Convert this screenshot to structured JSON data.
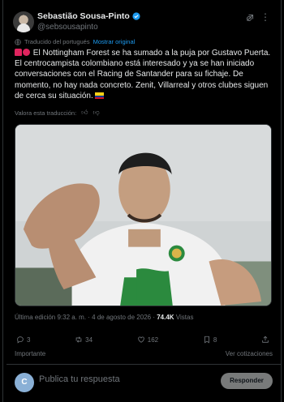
{
  "header": {
    "name": "Sebastião Sousa-Pinto",
    "handle": "@sebsousapinto"
  },
  "translation": {
    "note": "Traducido del portugués",
    "show_original": "Mostrar original"
  },
  "tweet": {
    "text": "El Nottingham Forest se ha sumado a la puja por Gustavo Puerta. El centrocampista colombiano está interesado y ya se han iniciado conversaciones con el Racing de Santander para su fichaje. De momento, no hay nada concreto. Zenit, Villarreal y otros clubes siguen de cerca su situación."
  },
  "rate_translation": "Valora esta traducción:",
  "meta": {
    "edited": "Última edición 9:32 a. m. · 4 de agosto de 2026 · ",
    "views_count": "74.4K",
    "views_label": " Vistas"
  },
  "actions": {
    "replies": "3",
    "reposts": "34",
    "likes": "162",
    "bookmarks": "8"
  },
  "footer": {
    "important": "Importante",
    "quotes": "Ver cotizaciones"
  },
  "reply": {
    "avatar_letter": "C",
    "placeholder": "Publica tu respuesta",
    "button": "Responder"
  },
  "colors": {
    "accent": "#1d9bf0",
    "muted": "#71767b",
    "background": "#000000"
  }
}
